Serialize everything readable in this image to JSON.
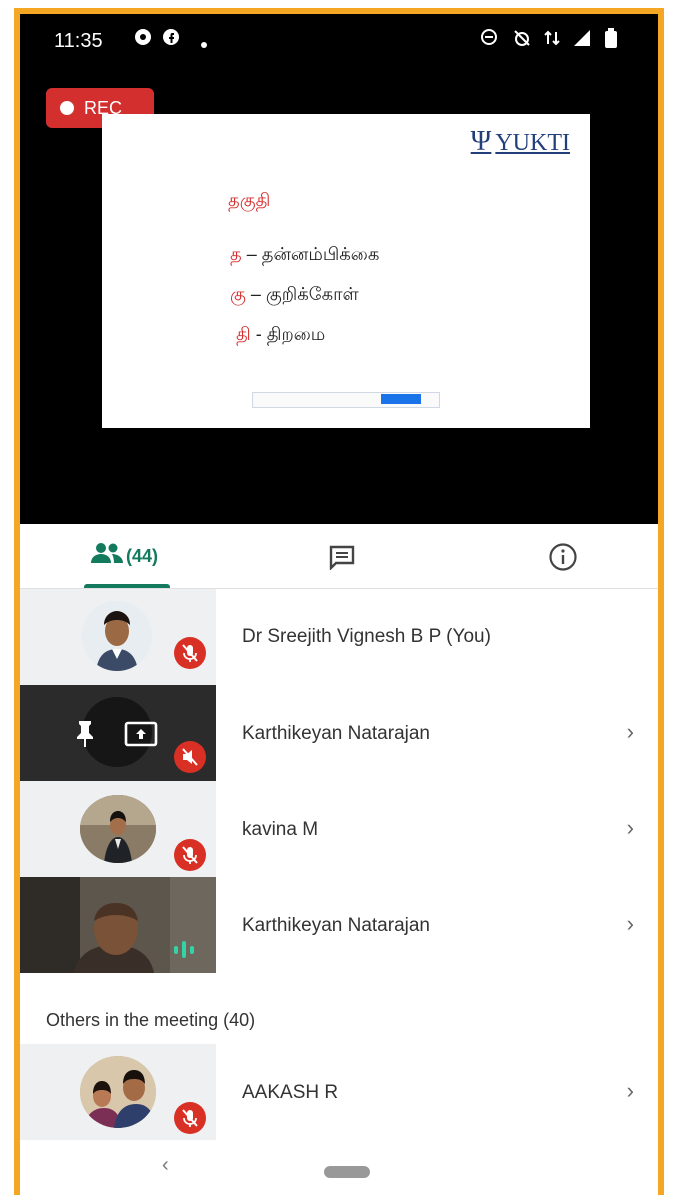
{
  "status_bar": {
    "time": "11:35"
  },
  "recording": {
    "label": "REC"
  },
  "slide": {
    "brand": "YUKTI",
    "title": "தகுதி",
    "lines": [
      {
        "key": "த",
        "text": " – தன்னம்பிக்கை"
      },
      {
        "key": "கு",
        "text": " – குறிக்கோள்"
      },
      {
        "key": "தி",
        "text": " - திறமை"
      }
    ]
  },
  "tabs": {
    "people_count": "(44)"
  },
  "participants": [
    {
      "name": "Dr Sreejith Vignesh B P (You)",
      "mic": "muted",
      "tile": "photo"
    },
    {
      "name": "Karthikeyan Natarajan",
      "mic": "muted",
      "tile": "presenting"
    },
    {
      "name": "kavina M",
      "mic": "muted",
      "tile": "photo"
    },
    {
      "name": "Karthikeyan Natarajan",
      "mic": "speaking",
      "tile": "video"
    }
  ],
  "others": {
    "heading": "Others in the meeting (40)",
    "items": [
      {
        "name": "AAKASH R",
        "mic": "muted"
      }
    ]
  },
  "colors": {
    "accent": "#137a5e",
    "frame": "#f5a623",
    "rec": "#d32f2f",
    "mute": "#d93025"
  }
}
